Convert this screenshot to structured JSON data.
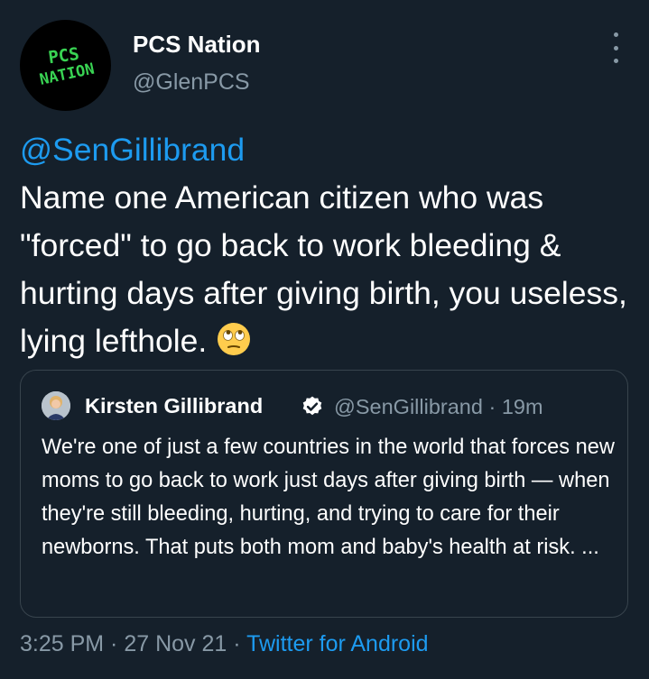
{
  "author": {
    "name": "PCS Nation",
    "handle": "@GlenPCS",
    "avatar_text_1": "PCS",
    "avatar_text_2": "NATION"
  },
  "tweet": {
    "mention": "@SenGillibrand",
    "body": "Name one American citizen who was \"forced\" to go back to work bleeding & hurting days after giving birth, you useless, lying lefthole.",
    "emoji": "face-with-rolling-eyes-emoji"
  },
  "quoted": {
    "name": "Kirsten Gillibrand",
    "handle_time": "@SenGillibrand · 19m",
    "text": "We're one of just a few countries in the world that forces new moms to go back to work just days after giving birth — when they're still bleeding, hurting, and trying to care for their newborns. That puts both mom and baby's health at risk. ..."
  },
  "footer": {
    "time": "3:25 PM · 27 Nov 21 · ",
    "source": "Twitter for Android"
  },
  "colors": {
    "background": "#15202b",
    "link": "#1d9bf0",
    "secondary_text": "#8899a6",
    "avatar_lettering": "#39d353"
  }
}
